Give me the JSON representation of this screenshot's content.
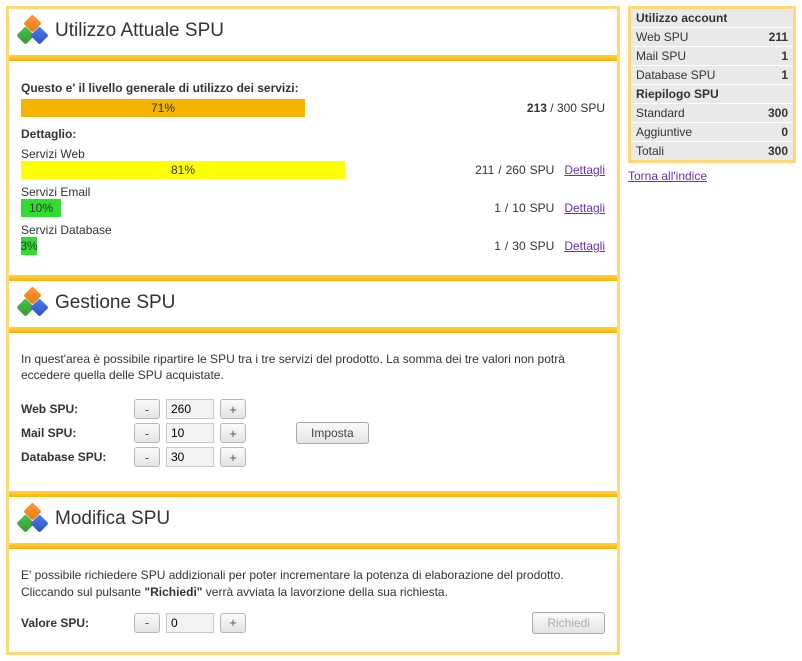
{
  "sections": {
    "usage": {
      "title": "Utilizzo Attuale SPU",
      "lead": "Questo e' il livello generale di utilizzo dei servizi:",
      "overall": {
        "pct": "71%",
        "used": "213",
        "total": "300",
        "unit": "SPU"
      },
      "detail_label": "Dettaglio:",
      "services": [
        {
          "name": "Servizi Web",
          "pct": "81%",
          "used": "211",
          "total": "260",
          "unit": "SPU",
          "link": "Dettagli",
          "width": 81,
          "color": "bar-yellow"
        },
        {
          "name": "Servizi Email",
          "pct": "10%",
          "used": "1",
          "total": "10",
          "unit": "SPU",
          "link": "Dettagli",
          "width": 10,
          "color": "bar-green"
        },
        {
          "name": "Servizi Database",
          "pct": "3%",
          "used": "1",
          "total": "30",
          "unit": "SPU",
          "link": "Dettagli",
          "width": 3,
          "color": "bar-green"
        }
      ]
    },
    "manage": {
      "title": "Gestione SPU",
      "para": "In quest'area è possibile ripartire le SPU tra i tre servizi del prodotto. La somma dei tre valori non potrà eccedere quella delle SPU acquistate.",
      "rows": [
        {
          "label": "Web SPU:",
          "value": "260"
        },
        {
          "label": "Mail SPU:",
          "value": "10"
        },
        {
          "label": "Database SPU:",
          "value": "30"
        }
      ],
      "submit": "Imposta"
    },
    "modify": {
      "title": "Modifica SPU",
      "para_html": "E' possibile richiedere SPU addizionali per poter incrementare la potenza di elaborazione del prodotto. Cliccando sul pulsante \"Richiedi\" verrà avviata la lavorzione della sua richiesta.",
      "row": {
        "label": "Valore SPU:",
        "value": "0"
      },
      "submit": "Richiedi"
    }
  },
  "sidebar": {
    "group1_title": "Utilizzo account",
    "group1": [
      {
        "label": "Web SPU",
        "value": "211"
      },
      {
        "label": "Mail SPU",
        "value": "1"
      },
      {
        "label": "Database SPU",
        "value": "1"
      }
    ],
    "group2_title": "Riepilogo SPU",
    "group2": [
      {
        "label": "Standard",
        "value": "300"
      },
      {
        "label": "Aggiuntive",
        "value": "0"
      },
      {
        "label": "Totali",
        "value": "300"
      }
    ],
    "back": "Torna all'indice"
  },
  "glyphs": {
    "minus": "-",
    "plus": "+"
  }
}
